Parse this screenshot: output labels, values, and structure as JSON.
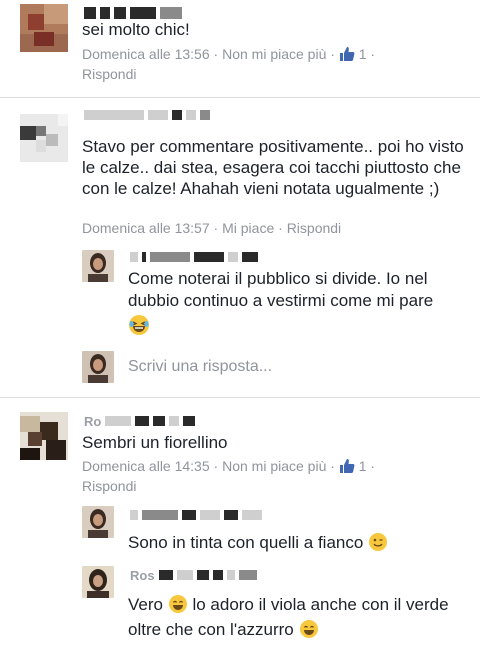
{
  "comments": [
    {
      "text": "sei molto chic!",
      "meta": {
        "time": "Domenica alle 13:56",
        "like": "Non mi piace più",
        "likes": "1",
        "reply": "Rispondi"
      }
    },
    {
      "text": "Stavo per commentare positivamente.. poi ho visto le calze.. dai stea, esagera coi tacchi piuttosto che con le calze! Ahahah vieni notata ugualmente ;)",
      "meta": {
        "time": "Domenica alle 13:57",
        "like": "Mi piace",
        "reply": "Rispondi"
      },
      "replies": [
        {
          "name": "A      Corr",
          "text": "Come noterai il pubblico si divide. Io nel dubbio continuo a vestirmi come mi pare"
        }
      ],
      "reply_placeholder": "Scrivi una risposta..."
    },
    {
      "name": "Ro",
      "text": "Sembri un fiorellino",
      "meta": {
        "time": "Domenica alle 14:35",
        "like": "Non mi piace più",
        "likes": "1",
        "reply": "Rispondi"
      },
      "replies": [
        {
          "name": "A      C      zz",
          "text": "Sono in tinta con quelli a fianco"
        },
        {
          "name": "Ros",
          "text": "Vero",
          "text2": "lo adoro il viola anche con il verde oltre che con l'azzurro"
        }
      ]
    }
  ],
  "colors": {
    "meta": "#90949c",
    "like_blue": "#4267b2",
    "divider": "#dcdee3"
  },
  "icons": [
    "thumbs-up-icon",
    "laughing-emoji",
    "winking-emoji",
    "smiling-emoji"
  ]
}
